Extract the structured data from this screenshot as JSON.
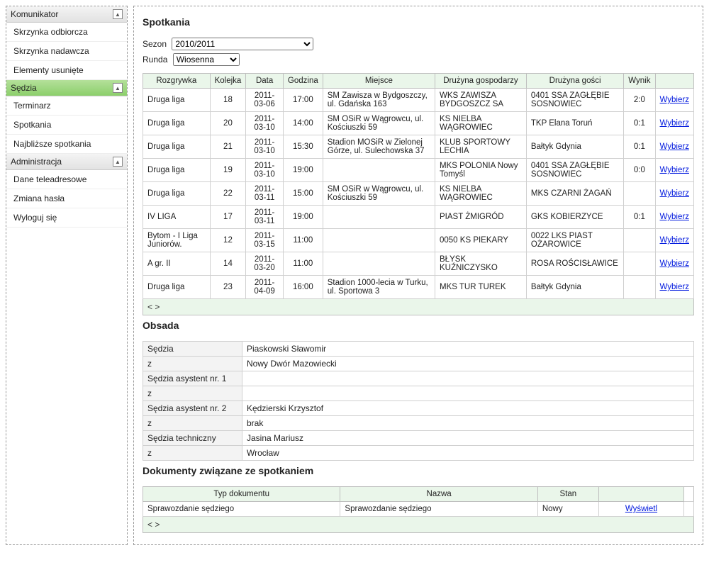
{
  "sidebar": {
    "sections": [
      {
        "title": "Komunikator",
        "active": false,
        "items": [
          "Skrzynka odbiorcza",
          "Skrzynka nadawcza",
          "Elementy usunięte"
        ]
      },
      {
        "title": "Sędzia",
        "active": true,
        "items": [
          "Terminarz",
          "Spotkania",
          "Najbliższe spotkania"
        ]
      },
      {
        "title": "Administracja",
        "active": false,
        "items": [
          "Dane teleadresowe",
          "Zmiana hasła",
          "Wyloguj się"
        ]
      }
    ]
  },
  "main": {
    "spotkania": {
      "heading": "Spotkania",
      "sezon_label": "Sezon",
      "sezon_value": "2010/2011",
      "runda_label": "Runda",
      "runda_value": "Wiosenna",
      "headers": [
        "Rozgrywka",
        "Kolejka",
        "Data",
        "Godzina",
        "Miejsce",
        "Drużyna gospodarzy",
        "Drużyna gości",
        "Wynik",
        ""
      ],
      "select_label": "Wybierz",
      "pager": "< >",
      "rows": [
        {
          "rozgrywka": "Druga liga",
          "kolejka": "18",
          "data": "2011-03-06",
          "godzina": "17:00",
          "miejsce": "SM Zawisza w Bydgoszczy, ul. Gdańska 163",
          "gospodarz": "WKS ZAWISZA BYDGOSZCZ SA",
          "gosc": "0401 SSA ZAGŁĘBIE SOSNOWIEC",
          "wynik": "2:0"
        },
        {
          "rozgrywka": "Druga liga",
          "kolejka": "20",
          "data": "2011-03-10",
          "godzina": "14:00",
          "miejsce": "SM OSiR w Wągrowcu, ul. Kościuszki 59",
          "gospodarz": "KS NIELBA WĄGROWIEC",
          "gosc": "TKP Elana Toruń",
          "wynik": "0:1"
        },
        {
          "rozgrywka": "Druga liga",
          "kolejka": "21",
          "data": "2011-03-10",
          "godzina": "15:30",
          "miejsce": "Stadion MOSiR w Zielonej Górze, ul. Sulechowska 37",
          "gospodarz": "KLUB SPORTOWY LECHIA",
          "gosc": "Bałtyk Gdynia",
          "wynik": "0:1"
        },
        {
          "rozgrywka": "Druga liga",
          "kolejka": "19",
          "data": "2011-03-10",
          "godzina": "19:00",
          "miejsce": "",
          "gospodarz": "MKS POLONIA Nowy Tomyśl",
          "gosc": "0401 SSA ZAGŁĘBIE SOSNOWIEC",
          "wynik": "0:0"
        },
        {
          "rozgrywka": "Druga liga",
          "kolejka": "22",
          "data": "2011-03-11",
          "godzina": "15:00",
          "miejsce": "SM OSiR w Wągrowcu, ul. Kościuszki 59",
          "gospodarz": "KS NIELBA WĄGROWIEC",
          "gosc": "MKS CZARNI ŻAGAŃ",
          "wynik": ""
        },
        {
          "rozgrywka": "IV LIGA",
          "kolejka": "17",
          "data": "2011-03-11",
          "godzina": "19:00",
          "miejsce": "",
          "gospodarz": "PIAST ŻMIGRÓD",
          "gosc": "GKS KOBIERZYCE",
          "wynik": "0:1"
        },
        {
          "rozgrywka": "Bytom - I Liga Juniorów.",
          "kolejka": "12",
          "data": "2011-03-15",
          "godzina": "11:00",
          "miejsce": "",
          "gospodarz": "0050 KS PIEKARY",
          "gosc": "0022 LKS PIAST OŻAROWICE",
          "wynik": ""
        },
        {
          "rozgrywka": "A gr. II",
          "kolejka": "14",
          "data": "2011-03-20",
          "godzina": "11:00",
          "miejsce": "",
          "gospodarz": "BŁYSK KUŹNICZYSKO",
          "gosc": "ROSA ROŚCISŁAWICE",
          "wynik": ""
        },
        {
          "rozgrywka": "Druga liga",
          "kolejka": "23",
          "data": "2011-04-09",
          "godzina": "16:00",
          "miejsce": "Stadion 1000-lecia w Turku, ul. Sportowa 3",
          "gospodarz": "MKS TUR TUREK",
          "gosc": "Bałtyk Gdynia",
          "wynik": ""
        }
      ]
    },
    "obsada": {
      "heading": "Obsada",
      "rows": [
        {
          "k": "Sędzia",
          "v": "Piaskowski Sławomir"
        },
        {
          "k": "z",
          "v": "Nowy Dwór Mazowiecki"
        },
        {
          "k": "Sędzia asystent nr. 1",
          "v": ""
        },
        {
          "k": "z",
          "v": ""
        },
        {
          "k": "Sędzia asystent nr. 2",
          "v": "Kędzierski Krzysztof"
        },
        {
          "k": "z",
          "v": "brak"
        },
        {
          "k": "Sędzia techniczny",
          "v": "Jasina Mariusz"
        },
        {
          "k": "z",
          "v": "Wrocław"
        }
      ]
    },
    "dokumenty": {
      "heading": "Dokumenty związane ze spotkaniem",
      "headers": [
        "Typ dokumentu",
        "Nazwa",
        "Stan",
        ""
      ],
      "view_label": "Wyświetl",
      "pager": "< >",
      "rows": [
        {
          "typ": "Sprawozdanie sędziego",
          "nazwa": "Sprawozdanie sędziego",
          "stan": "Nowy"
        }
      ]
    }
  }
}
